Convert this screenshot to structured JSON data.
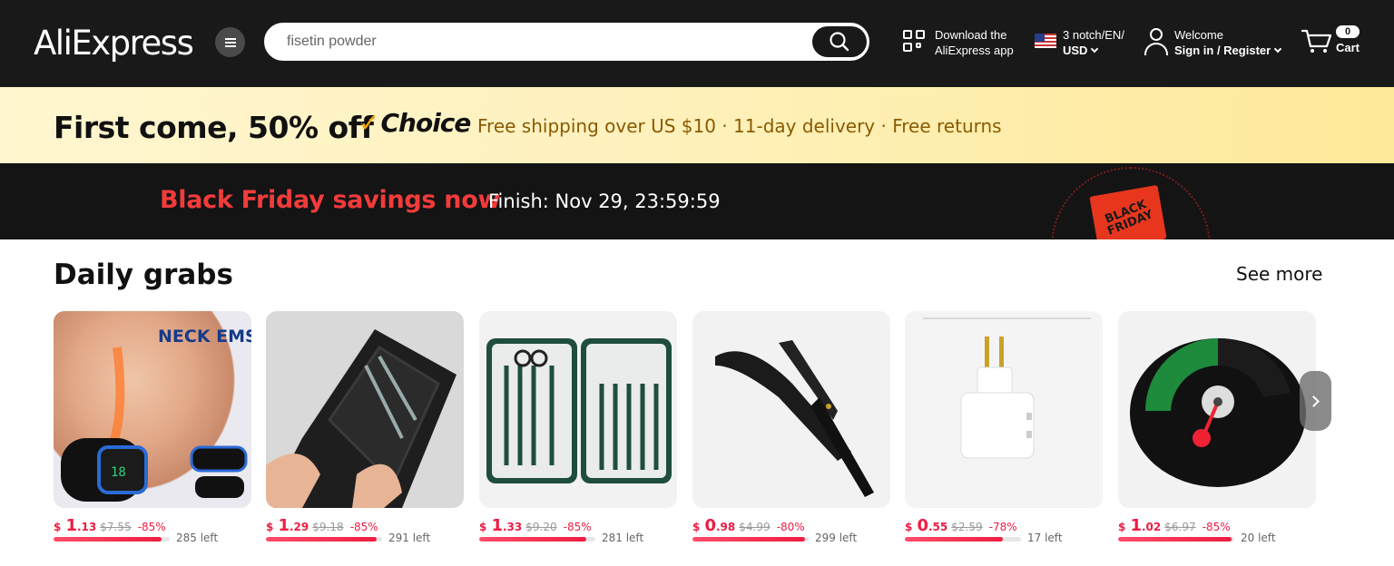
{
  "header": {
    "logo": "AliExpress",
    "search_value": "fisetin powder",
    "app_line1": "Download the",
    "app_line2": "AliExpress app",
    "locale_line1": "3 notch/EN/",
    "locale_line2": "USD",
    "welcome": "Welcome",
    "signin": "Sign in / Register",
    "cart_count": "0",
    "cart_label": "Cart"
  },
  "promo": {
    "title": "First come, 50% off",
    "choice_label": "Choice",
    "subtitle": "Free shipping over US $10 · 11-day delivery · Free returns"
  },
  "black_friday": {
    "title": "Black Friday savings now",
    "timer": "Finish: Nov 29, 23:59:59",
    "badge": "BLACK FRIDAY"
  },
  "daily_grabs": {
    "title": "Daily grabs",
    "see_more": "See more",
    "products": [
      {
        "icon": "neck-massager-image",
        "currency": "$",
        "int": "1",
        "dec": ".13",
        "old": "$7.55",
        "off": "-85%",
        "left": "285 left",
        "progress": 0.93,
        "thumb_text": "NECK EMS"
      },
      {
        "icon": "nail-clipper-case-image",
        "currency": "$",
        "int": "1",
        "dec": ".29",
        "old": "$9.18",
        "off": "-85%",
        "left": "291 left",
        "progress": 0.95
      },
      {
        "icon": "manicure-kit-image",
        "currency": "$",
        "int": "1",
        "dec": ".33",
        "old": "$9.20",
        "off": "-85%",
        "left": "281 left",
        "progress": 0.92
      },
      {
        "icon": "straight-razor-image",
        "currency": "$",
        "int": "0",
        "dec": ".98",
        "old": "$4.99",
        "off": "-80%",
        "left": "299 left",
        "progress": 0.97
      },
      {
        "icon": "plug-adapter-image",
        "currency": "$",
        "int": "0",
        "dec": ".55",
        "old": "$2.59",
        "off": "-78%",
        "left": "17 left",
        "progress": 0.84
      },
      {
        "icon": "stove-thermometer-image",
        "currency": "$",
        "int": "1",
        "dec": ".02",
        "old": "$6.97",
        "off": "-85%",
        "left": "20 left",
        "progress": 0.98
      }
    ]
  },
  "colors": {
    "header_bg": "#191919",
    "accent_red": "#ee1c43",
    "choice_gold": "#f6a800"
  }
}
